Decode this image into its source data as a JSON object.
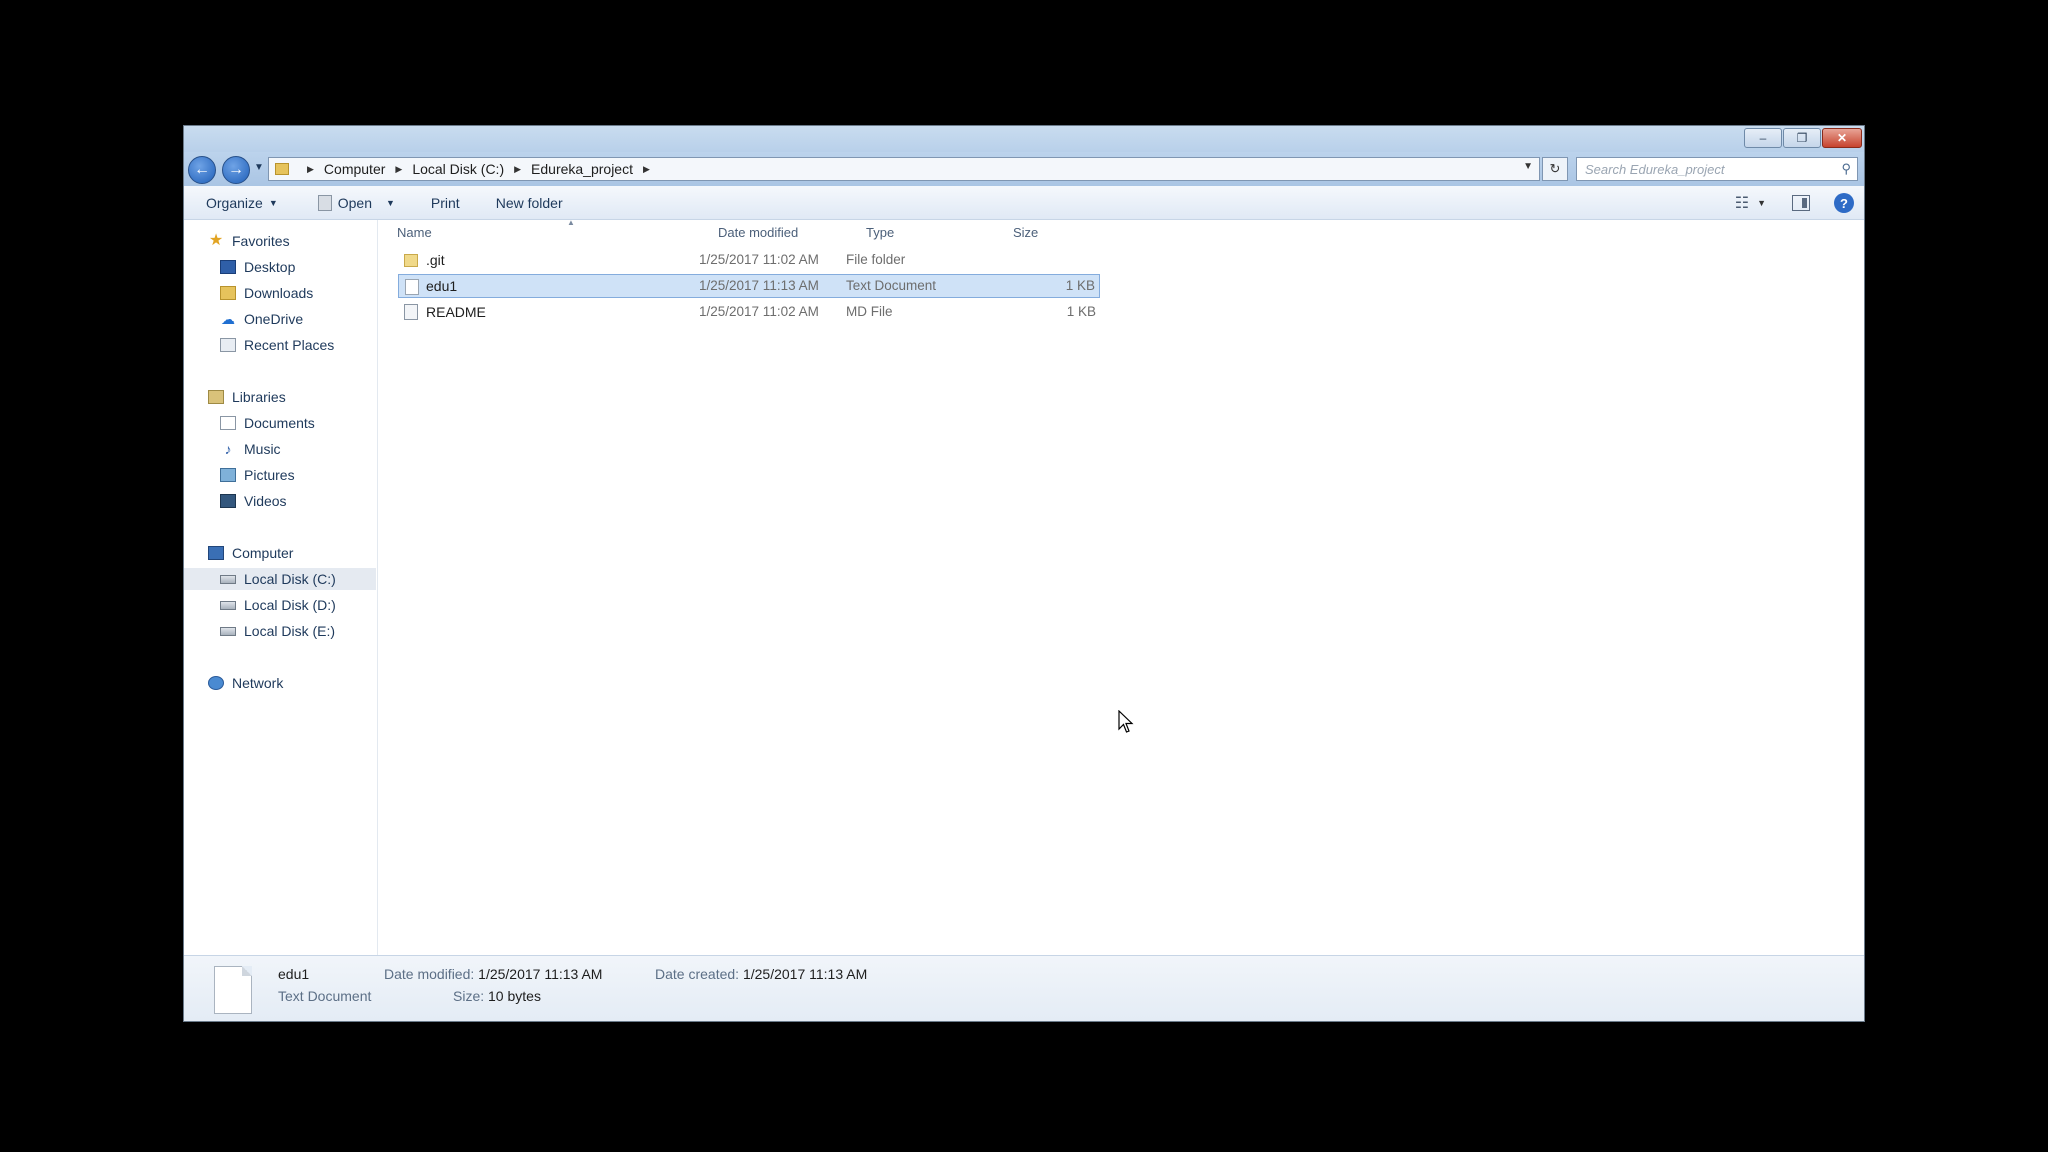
{
  "window": {
    "caption_buttons": {
      "minimize": "–",
      "maximize": "❐",
      "close": "✕"
    }
  },
  "address": {
    "breadcrumbs": [
      "Computer",
      "Local Disk (C:)",
      "Edureka_project"
    ],
    "search_placeholder": "Search Edureka_project"
  },
  "toolbar": {
    "organize": "Organize",
    "open": "Open",
    "print": "Print",
    "new_folder": "New folder"
  },
  "nav": {
    "favorites": "Favorites",
    "favorites_items": [
      "Desktop",
      "Downloads",
      "OneDrive",
      "Recent Places"
    ],
    "libraries": "Libraries",
    "libraries_items": [
      "Documents",
      "Music",
      "Pictures",
      "Videos"
    ],
    "computer": "Computer",
    "computer_items": [
      "Local Disk (C:)",
      "Local Disk (D:)",
      "Local Disk (E:)"
    ],
    "network": "Network",
    "selected": "Local Disk (C:)"
  },
  "columns": {
    "name": "Name",
    "date": "Date modified",
    "type": "Type",
    "size": "Size"
  },
  "files": [
    {
      "name": ".git",
      "date": "1/25/2017 11:02 AM",
      "type": "File folder",
      "size": "",
      "icon": "folder-icon"
    },
    {
      "name": "edu1",
      "date": "1/25/2017 11:13 AM",
      "type": "Text Document",
      "size": "1 KB",
      "icon": "text-file-icon",
      "selected": true
    },
    {
      "name": "README",
      "date": "1/25/2017 11:02 AM",
      "type": "MD File",
      "size": "1 KB",
      "icon": "md-file-icon"
    }
  ],
  "details": {
    "name": "edu1",
    "type": "Text Document",
    "date_modified_label": "Date modified:",
    "date_modified": "1/25/2017 11:13 AM",
    "date_created_label": "Date created:",
    "date_created": "1/25/2017 11:13 AM",
    "size_label": "Size:",
    "size": "10 bytes"
  },
  "colors": {
    "accent": "#2e6bc6",
    "selection": "#cfe2f7",
    "selection_border": "#84acdd",
    "close_button": "#c7432d"
  }
}
